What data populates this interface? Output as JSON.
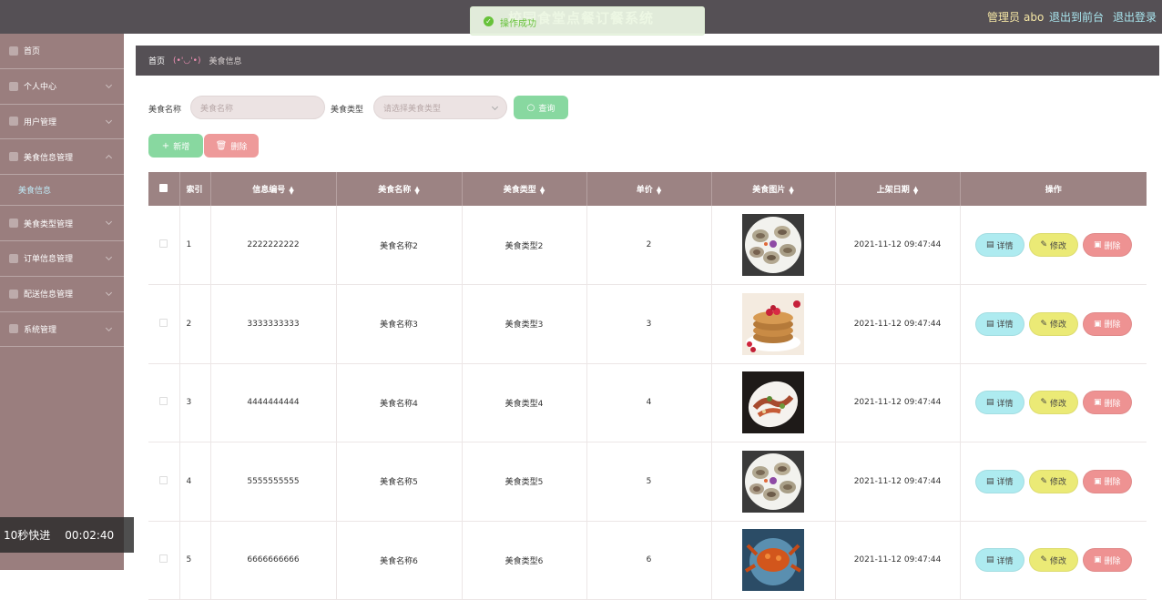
{
  "header": {
    "title": "校园食堂点餐订餐系统",
    "admin_label": "管理员",
    "admin_name": "abo",
    "back_link": "退出到前台",
    "logout_link": "退出登录"
  },
  "toast": {
    "message": "操作成功"
  },
  "sidebar": {
    "items": [
      {
        "label": "首页"
      },
      {
        "label": "个人中心"
      },
      {
        "label": "用户管理"
      },
      {
        "label": "美食信息管理"
      },
      {
        "label": "美食信息",
        "sub": true
      },
      {
        "label": "美食类型管理"
      },
      {
        "label": "订单信息管理"
      },
      {
        "label": "配送信息管理"
      },
      {
        "label": "系统管理"
      }
    ]
  },
  "breadcrumb": {
    "home": "首页",
    "face": "(•'◡'•)",
    "current": "美食信息"
  },
  "search": {
    "name_label": "美食名称",
    "name_placeholder": "美食名称",
    "type_label": "美食类型",
    "type_placeholder": "请选择美食类型",
    "query_button": "查询",
    "add_button": "新增",
    "delete_button": "删除"
  },
  "table": {
    "headers": [
      "索引",
      "信息编号",
      "美食名称",
      "美食类型",
      "单价",
      "美食图片",
      "上架日期",
      "操作"
    ],
    "rows": [
      {
        "index": "1",
        "code": "2222222222",
        "name": "美食名称2",
        "type": "美食类型2",
        "price": "2",
        "date": "2021-11-12 09:47:44"
      },
      {
        "index": "2",
        "code": "3333333333",
        "name": "美食名称3",
        "type": "美食类型3",
        "price": "3",
        "date": "2021-11-12 09:47:44"
      },
      {
        "index": "3",
        "code": "4444444444",
        "name": "美食名称4",
        "type": "美食类型4",
        "price": "4",
        "date": "2021-11-12 09:47:44"
      },
      {
        "index": "4",
        "code": "5555555555",
        "name": "美食名称5",
        "type": "美食类型5",
        "price": "5",
        "date": "2021-11-12 09:47:44"
      },
      {
        "index": "5",
        "code": "6666666666",
        "name": "美食名称6",
        "type": "美食类型6",
        "price": "6",
        "date": "2021-11-12 09:47:44"
      }
    ],
    "actions": {
      "detail": "详情",
      "edit": "修改",
      "delete": "删除"
    }
  },
  "overlay": {
    "speed": "10秒快进",
    "time": "00:02:40"
  },
  "colors": {
    "topbar": "#555055",
    "sidebar": "#9a7e7e",
    "table_header": "#9c8383",
    "query": "#88d8a0",
    "add": "#88d8a0",
    "delete": "#ee9a9a"
  }
}
